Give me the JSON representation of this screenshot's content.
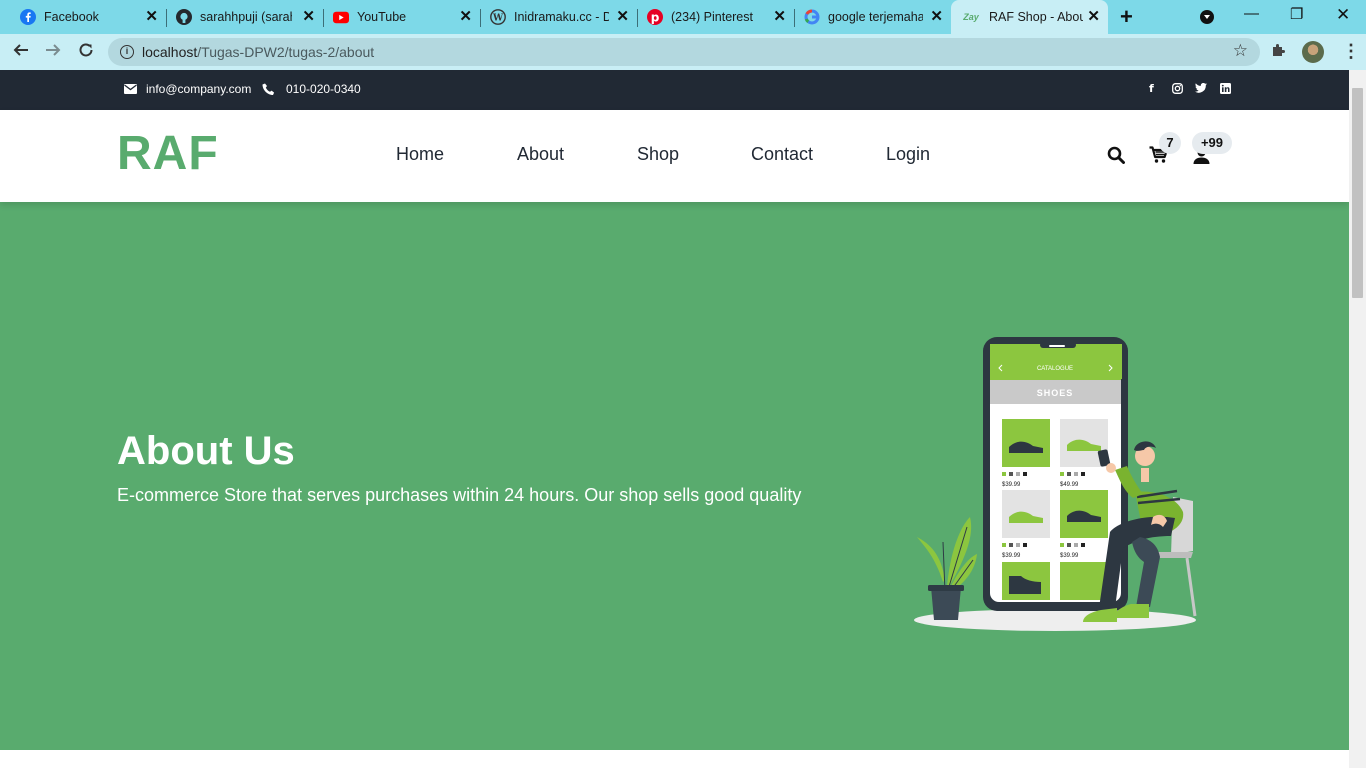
{
  "browser": {
    "tabs": [
      {
        "title": "Facebook",
        "icon": "facebook-icon"
      },
      {
        "title": "sarahhpuji (sarahl",
        "icon": "github-icon"
      },
      {
        "title": "YouTube",
        "icon": "youtube-icon"
      },
      {
        "title": "Inidramaku.cc - D",
        "icon": "wordpress-icon"
      },
      {
        "title": "(234) Pinterest",
        "icon": "pinterest-icon"
      },
      {
        "title": "google terjemaha",
        "icon": "google-icon"
      },
      {
        "title": "RAF Shop - Abou",
        "icon": "zay-icon",
        "favicon_text": "Zay"
      }
    ],
    "url_host": "localhost",
    "url_path": "/Tugas-DPW2/tugas-2/about"
  },
  "topbar": {
    "email": "info@company.com",
    "phone": "010-020-0340",
    "social": [
      "f",
      "instagram",
      "twitter",
      "in"
    ]
  },
  "navbar": {
    "logo": "RAF",
    "links": [
      "Home",
      "About",
      "Shop",
      "Contact",
      "Login"
    ],
    "cart_count": "7",
    "user_count": "+99"
  },
  "hero": {
    "title": "About Us",
    "subtitle": "E-commerce Store that serves purchases within 24 hours. Our shop sells good quality",
    "illustration": {
      "screen_header": "CATALOGUE",
      "category": "SHOES",
      "prices": [
        "$39.99",
        "$49.99",
        "$39.99",
        "$39.99"
      ]
    }
  },
  "colors": {
    "brand_green": "#59ab6e",
    "topbar_dark": "#212934",
    "tabbar": "#7dd9e8"
  }
}
